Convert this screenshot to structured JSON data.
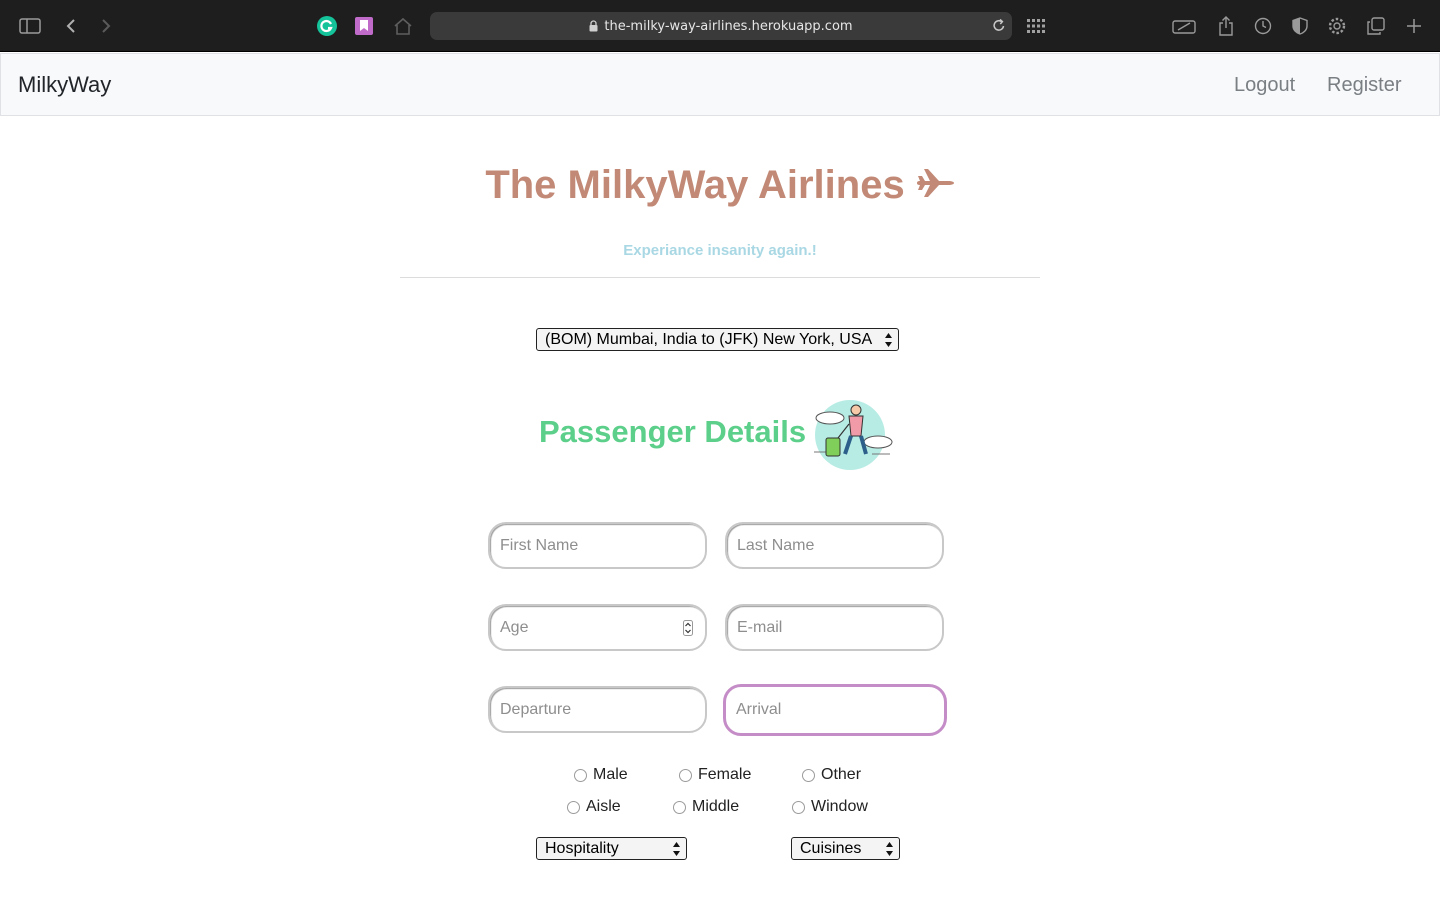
{
  "browser": {
    "url": "the-milky-way-airlines.herokuapp.com"
  },
  "navbar": {
    "brand": "MilkyWay",
    "links": [
      "Logout",
      "Register"
    ]
  },
  "hero": {
    "title": "The MilkyWay Airlines",
    "subtitle": "Experiance insanity again.!"
  },
  "route_select": {
    "selected": "(BOM) Mumbai, India to (JFK) New York, USA"
  },
  "passenger": {
    "heading": "Passenger Details",
    "fields": {
      "first_name": "First Name",
      "last_name": "Last Name",
      "age": "Age",
      "email": "E-mail",
      "departure": "Departure",
      "arrival": "Arrival"
    },
    "gender_options": [
      "Male",
      "Female",
      "Other"
    ],
    "seat_options": [
      "Aisle",
      "Middle",
      "Window"
    ],
    "hospitality_select": "Hospitality",
    "cuisines_select": "Cuisines"
  },
  "colors": {
    "title": "#c28a76",
    "subtitle": "#a9d8e4",
    "heading": "#5ccf8a",
    "focus_ring": "#c58dc7"
  }
}
